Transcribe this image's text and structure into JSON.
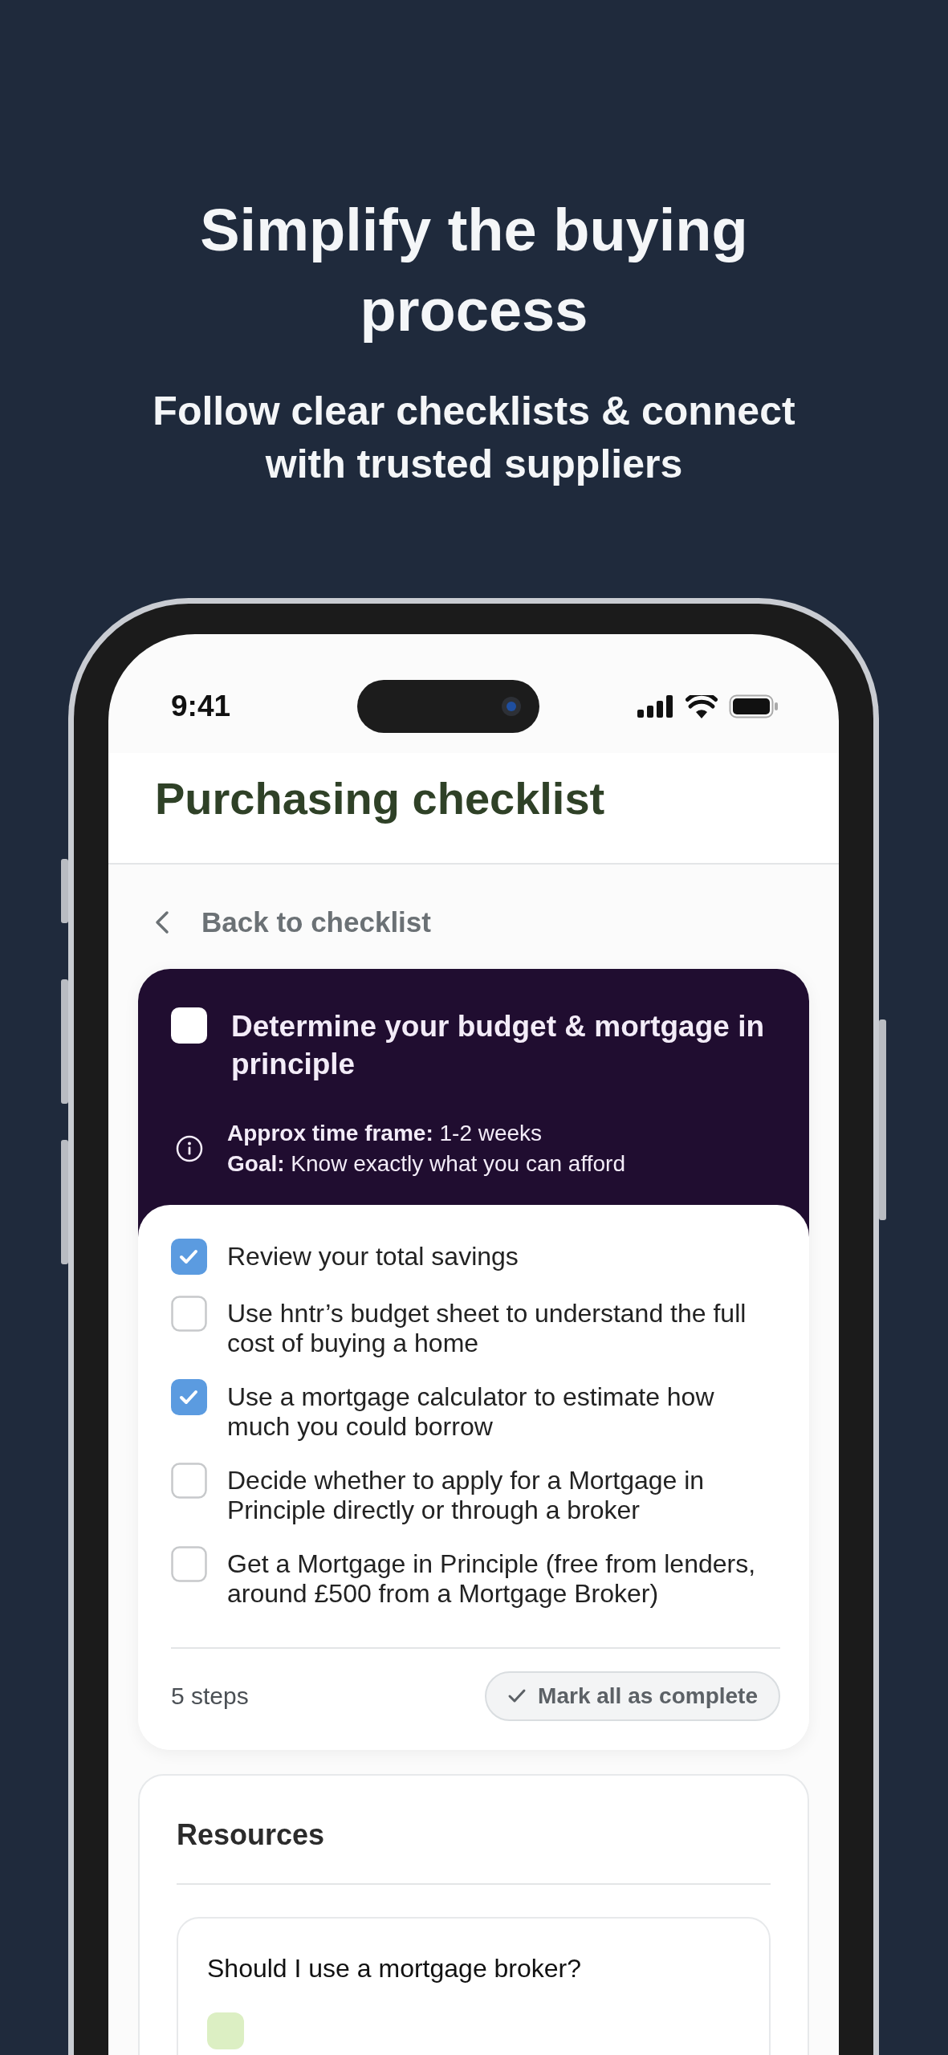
{
  "header": {
    "title": "Simplify the buying process",
    "subtitle": "Follow clear checklists & connect with trusted suppliers"
  },
  "status_bar": {
    "time": "9:41"
  },
  "screen_title": "Purchasing checklist",
  "back_link": "Back to checklist",
  "task": {
    "title": "Determine your budget & mortgage in principle",
    "checked": false,
    "info": [
      "**Approx time frame:** 1-2 weeks",
      "**Goal:** Know exactly what you can afford"
    ],
    "steps": [
      {
        "label": "Review your total savings",
        "checked": true
      },
      {
        "label": "Use hntr’s budget sheet to understand the full cost of buying a home",
        "checked": false
      },
      {
        "label": "Use a mortgage calculator to estimate how much you could borrow",
        "checked": true
      },
      {
        "label": "Decide whether to apply for a Mortgage in Principle directly or through a broker",
        "checked": false
      },
      {
        "label": "Get a Mortgage in Principle (free from lenders, around £500 from a Mortgage Broker)",
        "checked": false
      }
    ],
    "step_count": "5 steps",
    "mark_all_button": "Mark all as complete"
  },
  "resources": {
    "title": "Resources",
    "items": [
      {
        "title": "Should I use a mortgage broker?"
      }
    ]
  }
}
